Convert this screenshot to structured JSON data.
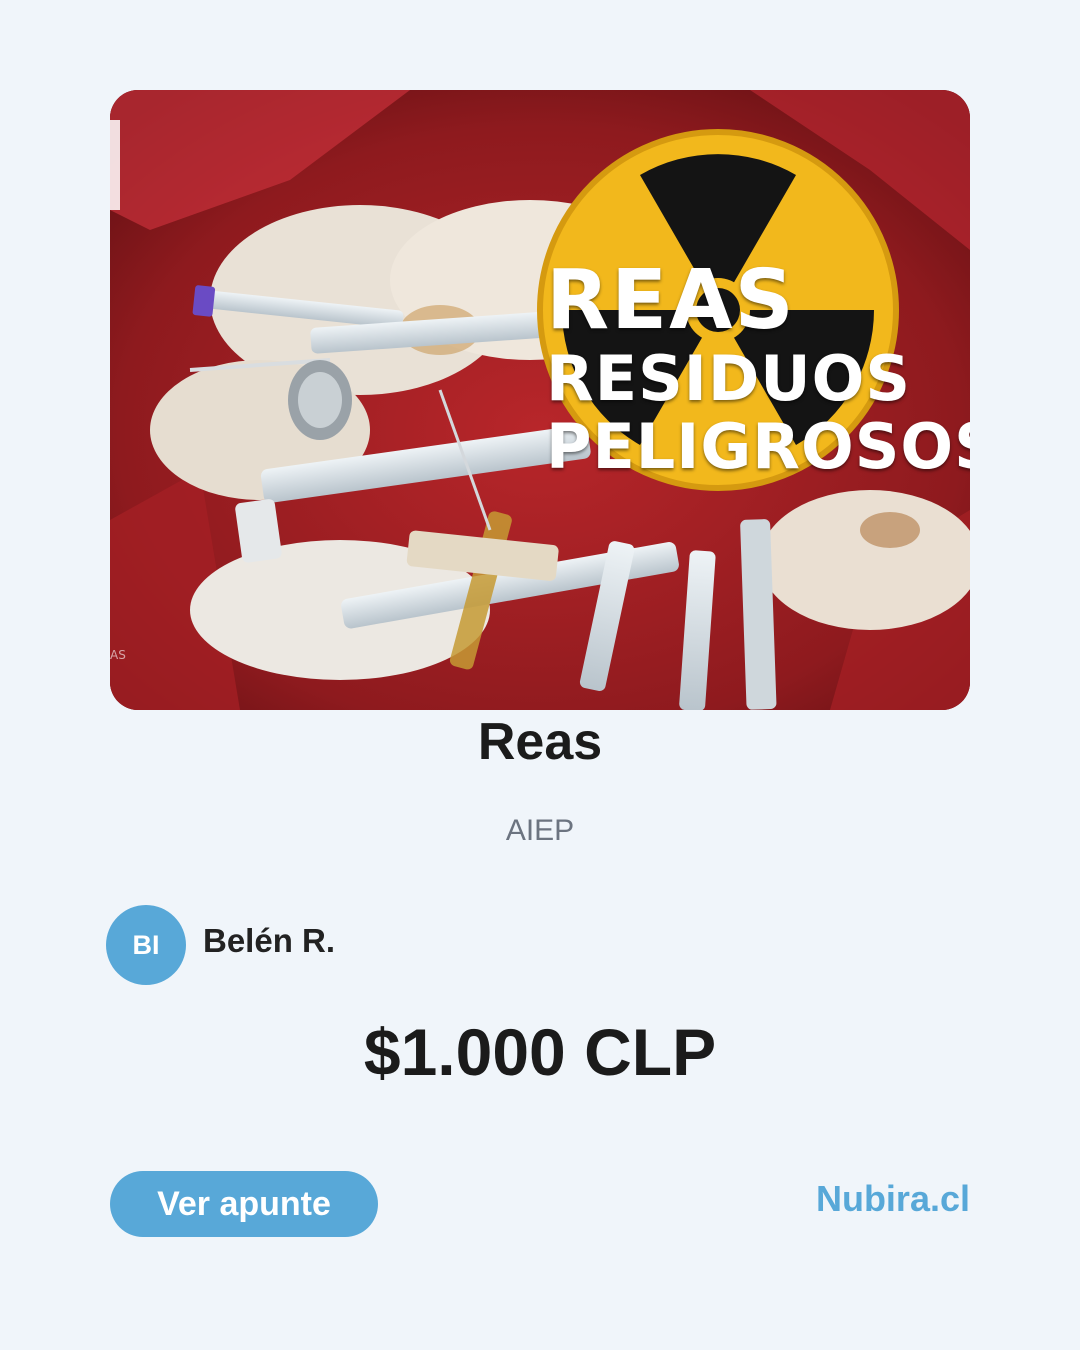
{
  "cover": {
    "headline": "REAS",
    "subline_1": "RESIDUOS",
    "subline_2": "PELIGROSOS",
    "corner_mark": "AS"
  },
  "title": "Reas",
  "institution": "AIEP",
  "author": {
    "initials": "BI",
    "name": "Belén R."
  },
  "price": "$1.000 CLP",
  "actions": {
    "view_label": "Ver apunte"
  },
  "brand": "Nubira.cl",
  "colors": {
    "accent": "#58a8d8",
    "background": "#f0f5fa",
    "hazard_yellow": "#f2b81c"
  }
}
